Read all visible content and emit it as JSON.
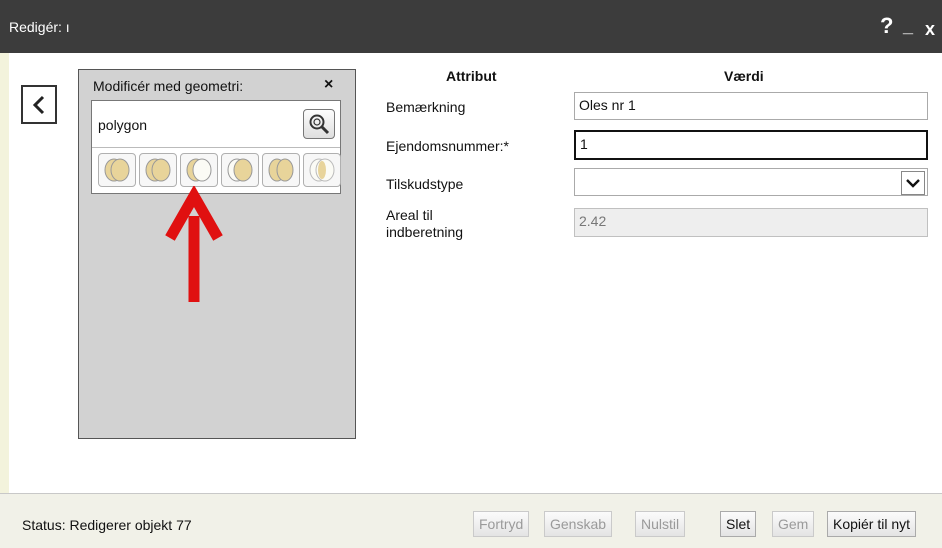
{
  "window": {
    "title": "Redigér: ı",
    "help_label": "?",
    "minimize_label": "_",
    "close_label": "x"
  },
  "back_button": {
    "icon": "chevron-left-icon"
  },
  "geometry_panel": {
    "header": "Modificér med geometri:",
    "close_label": "×",
    "geometry_type": "polygon",
    "zoom_icon": "zoom-to-icon",
    "tools": [
      {
        "name": "union-tool-icon"
      },
      {
        "name": "overlap-tool-icon"
      },
      {
        "name": "difference-tool-icon"
      },
      {
        "name": "subtract-tool-icon"
      },
      {
        "name": "split-tool-icon"
      },
      {
        "name": "intersect-tool-icon"
      }
    ]
  },
  "form": {
    "col_attribute": "Attribut",
    "col_value": "Værdi",
    "fields": [
      {
        "label": "Bemærkning",
        "value": "Oles nr 1"
      },
      {
        "label": "Ejendomsnummer:*",
        "value": "1"
      },
      {
        "label": "Tilskudstype",
        "value": ""
      },
      {
        "label": "Areal til indberetning",
        "value": "2.42"
      }
    ]
  },
  "status": {
    "text": "Status: Redigerer objekt 77",
    "buttons": {
      "undo": "Fortryd",
      "redo": "Genskab",
      "reset": "Nulstil",
      "delete": "Slet",
      "save": "Gem",
      "copy_new": "Kopiér til nyt"
    }
  },
  "colors": {
    "titlebar": "#3c3c3c",
    "panel": "#d2d2d2",
    "arrow": "#e01010",
    "statusbar": "#f1f1e8"
  }
}
